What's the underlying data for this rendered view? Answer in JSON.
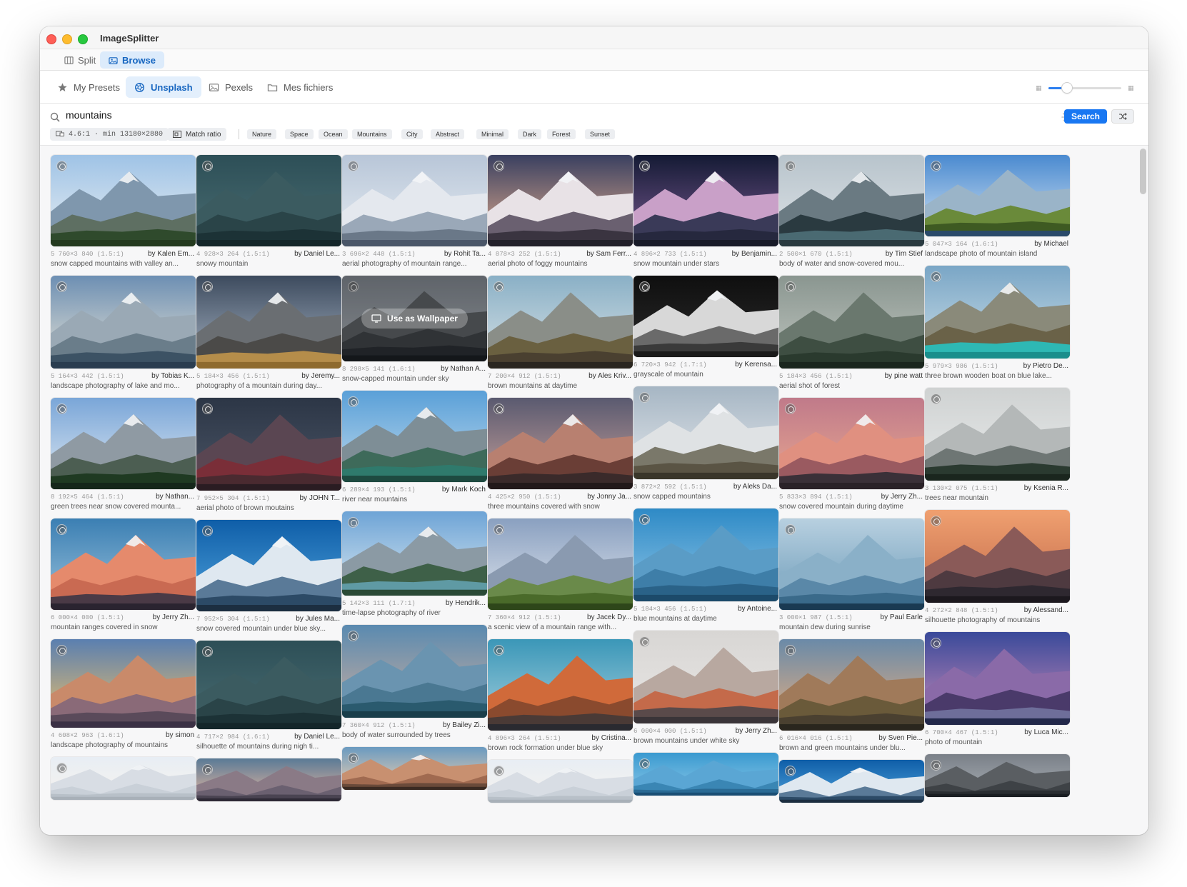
{
  "app": {
    "title": "ImageSplitter"
  },
  "tabs": [
    {
      "label": "Split",
      "active": false,
      "icon": "columns-icon"
    },
    {
      "label": "Browse",
      "active": true,
      "icon": "photos-icon"
    }
  ],
  "sources": [
    {
      "label": "My Presets",
      "icon": "star-icon",
      "active": false
    },
    {
      "label": "Unsplash",
      "icon": "aperture-icon",
      "active": true
    },
    {
      "label": "Pexels",
      "icon": "photo-icon",
      "active": false
    },
    {
      "label": "Mes fichiers",
      "icon": "folder-icon",
      "active": false
    }
  ],
  "zoom": {
    "value": 0.25
  },
  "search": {
    "value": "mountains",
    "placeholder": "",
    "button": "Search"
  },
  "filters": {
    "ratio": "4.6:1 · min 13180×2880",
    "match_ratio": "Match ratio"
  },
  "tags": [
    "Nature",
    "Space",
    "Ocean",
    "Mountains",
    "City",
    "Abstract",
    "Minimal",
    "Dark",
    "Forest",
    "Sunset"
  ],
  "hover": {
    "label": "Use as Wallpaper"
  },
  "colors": {
    "accent": "#1877f2"
  },
  "columns": [
    [
      {
        "dims": "5 760×3 840 (1.5:1)",
        "author": "by Kalen Em...",
        "desc": "snow capped mountains with valley an...",
        "scene": "valley"
      },
      {
        "dims": "5 164×3 442 (1.5:1)",
        "author": "by Tobias K...",
        "desc": "landscape photography of lake and mo...",
        "scene": "lake"
      },
      {
        "dims": "8 192×5 464 (1.5:1)",
        "author": "by Nathan...",
        "desc": "green trees near snow covered mounta...",
        "scene": "trees"
      },
      {
        "dims": "6 000×4 000 (1.5:1)",
        "author": "by Jerry Zh...",
        "desc": "mountain ranges covered in snow",
        "scene": "pinkpeak"
      },
      {
        "dims": "4 608×2 963 (1.6:1)",
        "author": "by simon",
        "desc": "landscape photography of mountains",
        "scene": "sunset"
      },
      {
        "dims": "",
        "author": "",
        "desc": "",
        "scene": "pale"
      }
    ],
    [
      {
        "dims": "4 928×3 264 (1.5:1)",
        "author": "by Daniel Le...",
        "desc": "snowy mountain",
        "scene": "teal"
      },
      {
        "dims": "5 184×3 456 (1.5:1)",
        "author": "by Jeremy...",
        "desc": "photography of a mountain during day...",
        "scene": "golden"
      },
      {
        "dims": "7 952×5 304 (1.5:1)",
        "author": "by JOHN T...",
        "desc": "aerial photo of brown moutains",
        "scene": "red"
      },
      {
        "dims": "7 952×5 304 (1.5:1)",
        "author": "by Jules Ma...",
        "desc": "snow covered mountain under blue sky...",
        "scene": "bluesnow"
      },
      {
        "dims": "4 717×2 984 (1.6:1)",
        "author": "by Daniel Le...",
        "desc": "silhouette of mountains during nigh ti...",
        "scene": "teal"
      },
      {
        "dims": "",
        "author": "",
        "desc": "",
        "scene": "dusk"
      }
    ],
    [
      {
        "dims": "3 696×2 448 (1.5:1)",
        "author": "by Rohit Ta...",
        "desc": "aerial photography of mountain range...",
        "scene": "whitepeak"
      },
      {
        "dims": "8 298×5 141 (1.6:1)",
        "author": "by Nathan A...",
        "desc": "snow-capped mountain under sky",
        "scene": "grey"
      },
      {
        "dims": "6 289×4 193 (1.5:1)",
        "author": "by Mark Koch",
        "desc": "river near mountains",
        "scene": "lakegreen"
      },
      {
        "dims": "5 142×3 111 (1.7:1)",
        "author": "by Hendrik...",
        "desc": "time-lapse photography of river",
        "scene": "river"
      },
      {
        "dims": "7 360×4 912 (1.5:1)",
        "author": "by Bailey Zi...",
        "desc": "body of water surrounded by trees",
        "scene": "forestblue"
      },
      {
        "dims": "",
        "author": "",
        "desc": "",
        "scene": "warm"
      }
    ],
    [
      {
        "dims": "4 878×3 252 (1.5:1)",
        "author": "by Sam Ferr...",
        "desc": "aerial photo of foggy mountains",
        "scene": "foggy"
      },
      {
        "dims": "7 200×4 912 (1.5:1)",
        "author": "by Ales Kriv...",
        "desc": "brown mountains at daytime",
        "scene": "brown"
      },
      {
        "dims": "4 425×2 950 (1.5:1)",
        "author": "by Jonny Ja...",
        "desc": "three mountains covered with snow",
        "scene": "duskpeak"
      },
      {
        "dims": "7 360×4 912 (1.5:1)",
        "author": "by Jacek Dy...",
        "desc": "a scenic view of a mountain range with...",
        "scene": "greenhill"
      },
      {
        "dims": "4 896×3 264 (1.5:1)",
        "author": "by Cristina...",
        "desc": "brown rock formation under blue sky",
        "scene": "rock"
      },
      {
        "dims": "",
        "author": "",
        "desc": "",
        "scene": "pale"
      }
    ],
    [
      {
        "dims": "4 896×2 733 (1.5:1)",
        "author": "by Benjamin...",
        "desc": "snow mountain under stars",
        "scene": "stars"
      },
      {
        "dims": "6 720×3 942 (1.7:1)",
        "author": "by Kerensa...",
        "desc": "grayscale of mountain",
        "scene": "bw"
      },
      {
        "dims": "3 872×2 592 (1.5:1)",
        "author": "by Aleks Da...",
        "desc": "snow capped mountains",
        "scene": "range"
      },
      {
        "dims": "5 184×3 456 (1.5:1)",
        "author": "by Antoine...",
        "desc": "blue mountains at daytime",
        "scene": "bluehaze"
      },
      {
        "dims": "6 000×4 000 (1.5:1)",
        "author": "by Jerry Zh...",
        "desc": "brown mountains under white sky",
        "scene": "twin"
      },
      {
        "dims": "",
        "author": "",
        "desc": "",
        "scene": "blue"
      }
    ],
    [
      {
        "dims": "2 500×1 670 (1.5:1)",
        "author": "by Tim Stief",
        "desc": "body of water and snow-covered mou...",
        "scene": "reflection"
      },
      {
        "dims": "5 184×3 456 (1.5:1)",
        "author": "by pine watt",
        "desc": "aerial shot of forest",
        "scene": "mistforest"
      },
      {
        "dims": "5 833×3 894 (1.5:1)",
        "author": "by Jerry Zh...",
        "desc": "snow covered mountain during daytime",
        "scene": "pinkrange"
      },
      {
        "dims": "3 000×1 987 (1.5:1)",
        "author": "by Paul Earle",
        "desc": "mountain dew during sunrise",
        "scene": "bluelayers"
      },
      {
        "dims": "6 016×4 016 (1.5:1)",
        "author": "by Sven Pie...",
        "desc": "brown and green mountains under blu...",
        "scene": "layers"
      },
      {
        "dims": "",
        "author": "",
        "desc": "",
        "scene": "bluesnow"
      }
    ],
    [
      {
        "dims": "5 047×3 164 (1.6:1)",
        "author": "by Michael",
        "desc": "landscape photo of mountain island",
        "scene": "island"
      },
      {
        "dims": "5 979×3 986 (1.5:1)",
        "author": "by Pietro De...",
        "desc": "three brown wooden boat on blue lake...",
        "scene": "turquoise"
      },
      {
        "dims": "3 130×2 075 (1.5:1)",
        "author": "by Ksenia R...",
        "desc": "trees near mountain",
        "scene": "fog"
      },
      {
        "dims": "4 272×2 848 (1.5:1)",
        "author": "by Alessand...",
        "desc": "silhouette photography of mountains",
        "scene": "orange"
      },
      {
        "dims": "6 700×4 467 (1.5:1)",
        "author": "by Luca Mic...",
        "desc": "photo of mountain",
        "scene": "purple"
      },
      {
        "dims": "",
        "author": "",
        "desc": "",
        "scene": "grey"
      }
    ]
  ]
}
